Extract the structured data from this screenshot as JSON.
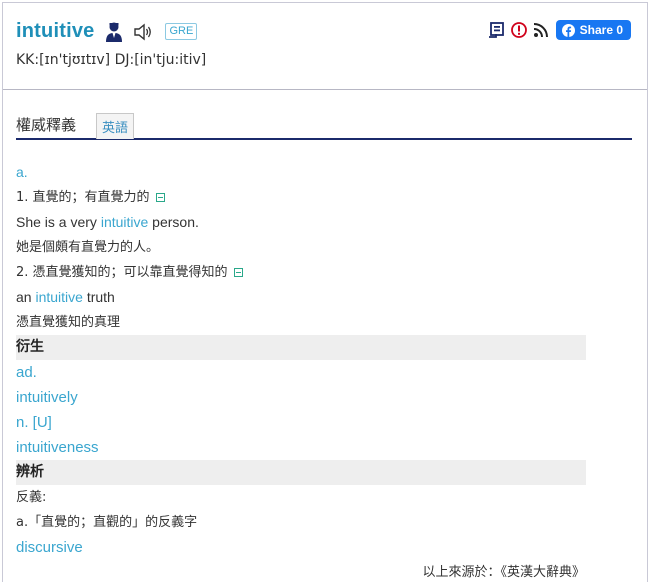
{
  "header": {
    "headword": "intuitive",
    "badge": "GRE",
    "phonetic": "KK:[ɪn'tjʊɪtɪv] DJ:[in'tju:itiv]",
    "share_label": "Share 0",
    "icons": [
      "person-icon",
      "speaker-icon",
      "flashcard-icon",
      "report-icon",
      "rss-icon",
      "facebook-icon"
    ],
    "brand_color": "#1877f2",
    "accent": "#1f8fb8"
  },
  "tabs": {
    "main_label": "權威釋義",
    "eng_label": "英語"
  },
  "entry": {
    "pos1": "a.",
    "def1": "1. 直覺的；有直覺力的",
    "ex1": {
      "pre": "She is a very ",
      "kw": "intuitive",
      "post": " person."
    },
    "ex1_zh": "她是個頗有直覺力的人。",
    "def2": "2. 憑直覺獲知的；可以靠直覺得知的",
    "ex2": {
      "pre": "an ",
      "kw": "intuitive",
      "post": " truth"
    },
    "ex2_zh": "憑直覺獲知的真理",
    "deriv_title": "衍生",
    "deriv_pos1": "ad.",
    "deriv_word1": "intuitively",
    "deriv_pos2": "n. [U]",
    "deriv_word2": "intuitiveness",
    "analysis_title": "辨析",
    "antonym_label": "反義:",
    "antonym_note": "a.「直覺的；直觀的」的反義字",
    "antonym_word": "discursive"
  },
  "source": "以上來源於：《英漢大辭典》"
}
